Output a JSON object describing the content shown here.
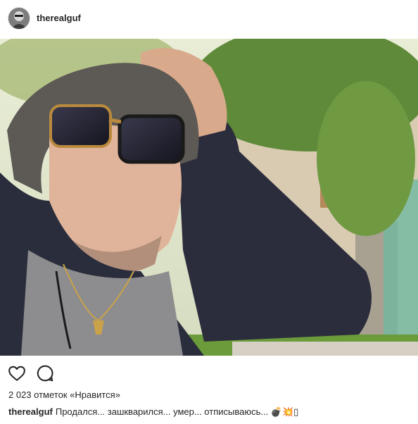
{
  "post": {
    "username": "therealguf",
    "likes_text": "2 023 отметок «Нравится»",
    "caption_user": "therealguf",
    "caption_text": "Продался... зашкварился... умер... отписываюсь... 💣💥▯"
  },
  "icons": {
    "like": "heart-outline-icon",
    "comment": "speech-bubble-icon"
  },
  "colors": {
    "text": "#262626",
    "border": "#dbdbdb",
    "background": "#ffffff"
  }
}
